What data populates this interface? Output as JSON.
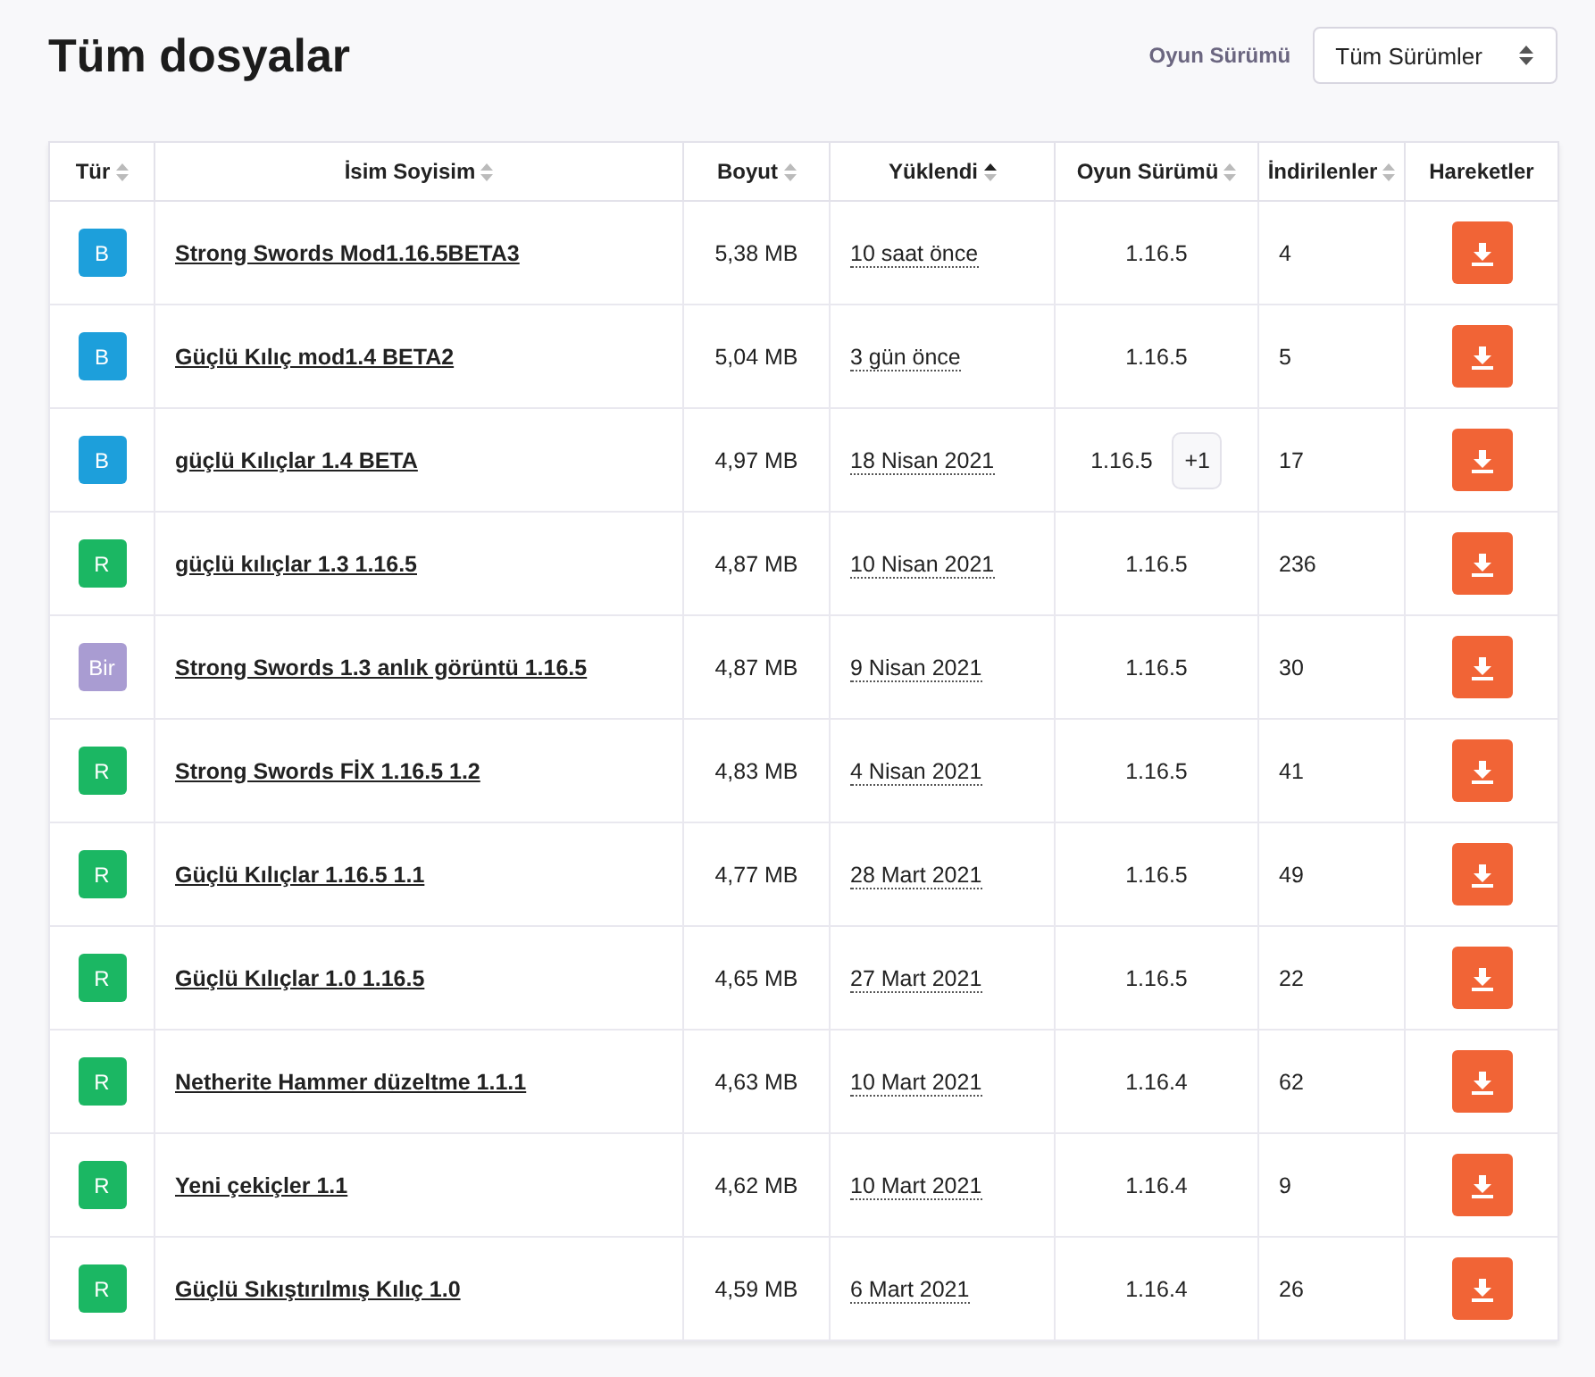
{
  "title": "Tüm dosyalar",
  "filter": {
    "label": "Oyun Sürümü",
    "value": "Tüm Sürümler"
  },
  "table": {
    "columns": [
      {
        "label": "Tür",
        "sortable": true,
        "sorted": false
      },
      {
        "label": "İsim Soyisim",
        "sortable": true,
        "sorted": false
      },
      {
        "label": "Boyut",
        "sortable": true,
        "sorted": false
      },
      {
        "label": "Yüklendi",
        "sortable": true,
        "sorted": true
      },
      {
        "label": "Oyun Sürümü",
        "sortable": true,
        "sorted": false
      },
      {
        "label": "İndirilenler",
        "sortable": true,
        "sorted": false
      },
      {
        "label": "Hareketler",
        "sortable": false
      }
    ],
    "rows": [
      {
        "type": "B",
        "color": "#1d9fdb",
        "name": "Strong Swords Mod1.16.5BETA3",
        "size": "5,38 MB",
        "uploaded": "10 saat önce",
        "version": "1.16.5",
        "downloads": "4"
      },
      {
        "type": "B",
        "color": "#1d9fdb",
        "name": "Güçlü Kılıç mod1.4 BETA2",
        "size": "5,04 MB",
        "uploaded": "3 gün önce",
        "version": "1.16.5",
        "downloads": "5"
      },
      {
        "type": "B",
        "color": "#1d9fdb",
        "name": "güçlü Kılıçlar 1.4 BETA",
        "size": "4,97 MB",
        "uploaded": "18 Nisan 2021",
        "version": "1.16.5",
        "extra_versions": "+1",
        "downloads": "17"
      },
      {
        "type": "R",
        "color": "#1bb763",
        "name": "güçlü kılıçlar 1.3 1.16.5",
        "size": "4,87 MB",
        "uploaded": "10 Nisan 2021",
        "version": "1.16.5",
        "downloads": "236"
      },
      {
        "type": "Bir",
        "color": "#a99cd2",
        "name": "Strong Swords 1.3 anlık görüntü 1.16.5",
        "size": "4,87 MB",
        "uploaded": "9 Nisan 2021",
        "version": "1.16.5",
        "downloads": "30"
      },
      {
        "type": "R",
        "color": "#1bb763",
        "name": "Strong Swords FİX 1.16.5 1.2",
        "size": "4,83 MB",
        "uploaded": "4 Nisan 2021",
        "version": "1.16.5",
        "downloads": "41"
      },
      {
        "type": "R",
        "color": "#1bb763",
        "name": "Güçlü Kılıçlar 1.16.5 1.1",
        "size": "4,77 MB",
        "uploaded": "28 Mart 2021",
        "version": "1.16.5",
        "downloads": "49"
      },
      {
        "type": "R",
        "color": "#1bb763",
        "name": "Güçlü Kılıçlar 1.0 1.16.5",
        "size": "4,65 MB",
        "uploaded": "27 Mart 2021",
        "version": "1.16.5",
        "downloads": "22"
      },
      {
        "type": "R",
        "color": "#1bb763",
        "name": "Netherite Hammer düzeltme 1.1.1",
        "size": "4,63 MB",
        "uploaded": "10 Mart 2021",
        "version": "1.16.4",
        "downloads": "62"
      },
      {
        "type": "R",
        "color": "#1bb763",
        "name": "Yeni çekiçler 1.1",
        "size": "4,62 MB",
        "uploaded": "10 Mart 2021",
        "version": "1.16.4",
        "downloads": "9"
      },
      {
        "type": "R",
        "color": "#1bb763",
        "name": "Güçlü Sıkıştırılmış Kılıç 1.0",
        "size": "4,59 MB",
        "uploaded": "6 Mart 2021",
        "version": "1.16.4",
        "downloads": "26"
      }
    ]
  }
}
